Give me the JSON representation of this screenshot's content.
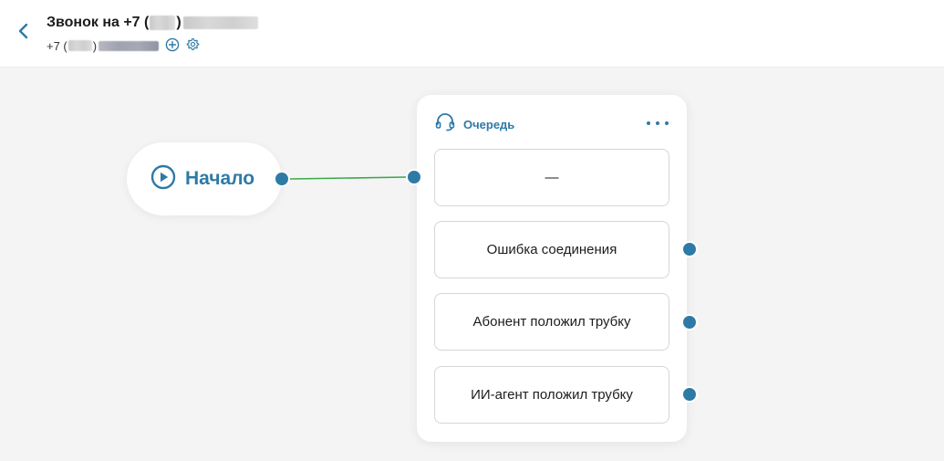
{
  "header": {
    "title_prefix": "Звонок на +7 (",
    "title_suffix": ")",
    "phone_prefix": "+7 (",
    "phone_suffix": ")",
    "back_icon": "chevron-left-icon",
    "add_icon": "plus-circle-icon",
    "settings_icon": "gear-icon"
  },
  "start_node": {
    "label": "Начало",
    "icon": "play-circle-icon"
  },
  "queue_node": {
    "title": "Очередь",
    "icon": "headset-icon",
    "menu_icon": "more-horizontal-icon",
    "outcomes": [
      {
        "label": "—"
      },
      {
        "label": "Ошибка соединения"
      },
      {
        "label": "Абонент положил трубку"
      },
      {
        "label": "ИИ-агент положил трубку"
      }
    ]
  },
  "colors": {
    "accent": "#2e7aa6",
    "link": "#3aa84a",
    "background": "#f4f4f4",
    "card": "#ffffff"
  }
}
